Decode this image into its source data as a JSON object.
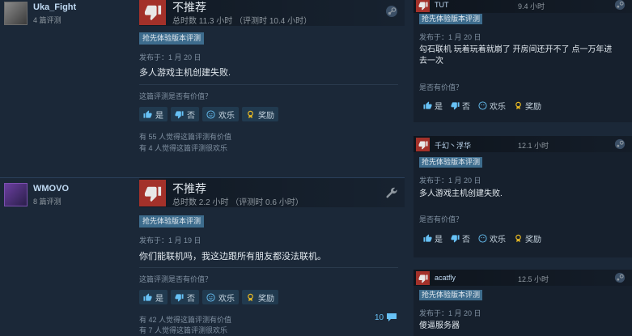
{
  "reviews": [
    {
      "author": "Uka_Fight",
      "review_count": "4 篇评测",
      "verdict": "不推荐",
      "hours": "总时数 11.3 小时 （评测时 10.4 小时）",
      "badge": "抢先体验版本评测",
      "date": "发布于：1 月 20 日",
      "text": "多人游戏主机创建失败.",
      "helpful_question": "这篇评测是否有价值？",
      "buttons": {
        "yes": "是",
        "no": "否",
        "funny": "欢乐",
        "award": "奖励"
      },
      "helpful_count": "有 55 人觉得这篇评测有价值",
      "funny_count": "有 4 人觉得这篇评测很欢乐"
    },
    {
      "author": "WMOVO",
      "review_count": "8 篇评测",
      "verdict": "不推荐",
      "hours": "总时数 2.2 小时 （评测时 0.6 小时）",
      "badge": "抢先体验版本评测",
      "date": "发布于：1 月 19 日",
      "text": "你们能联机吗，我这边跟所有朋友都没法联机。",
      "helpful_question": "这篇评测是否有价值？",
      "buttons": {
        "yes": "是",
        "no": "否",
        "funny": "欢乐",
        "award": "奖励"
      },
      "helpful_count": "有 42 人觉得这篇评测有价值",
      "funny_count": "有 7 人觉得这篇评测很欢乐",
      "comment_count": "10"
    }
  ],
  "side_reviews": [
    {
      "author": "TUT",
      "hours": "9.4 小时",
      "badge": "抢先体验版本评测",
      "date": "发布于：1 月 20 日",
      "text": "勾石联机 玩着玩着就崩了 开房间还开不了 点一万年进去一次",
      "helpful_question": "是否有价值？",
      "buttons": {
        "yes": "是",
        "no": "否",
        "funny": "欢乐",
        "award": "奖励"
      }
    },
    {
      "author": "千幻丶浮华",
      "hours": "12.1 小时",
      "badge": "抢先体验版本评测",
      "date": "发布于：1 月 20 日",
      "text": "多人游戏主机创建失败.",
      "helpful_question": "是否有价值？",
      "buttons": {
        "yes": "是",
        "no": "否",
        "funny": "欢乐",
        "award": "奖励"
      }
    },
    {
      "author": "acatfly",
      "hours": "12.5 小时",
      "badge": "抢先体验版本评测",
      "date": "发布于：1 月 20 日",
      "text": "傻逼服务器"
    }
  ],
  "colors": {
    "thumbs_down": "#a3312a",
    "badge": "#3d6c8d",
    "background": "#1b2838",
    "link": "#67c1f5"
  }
}
